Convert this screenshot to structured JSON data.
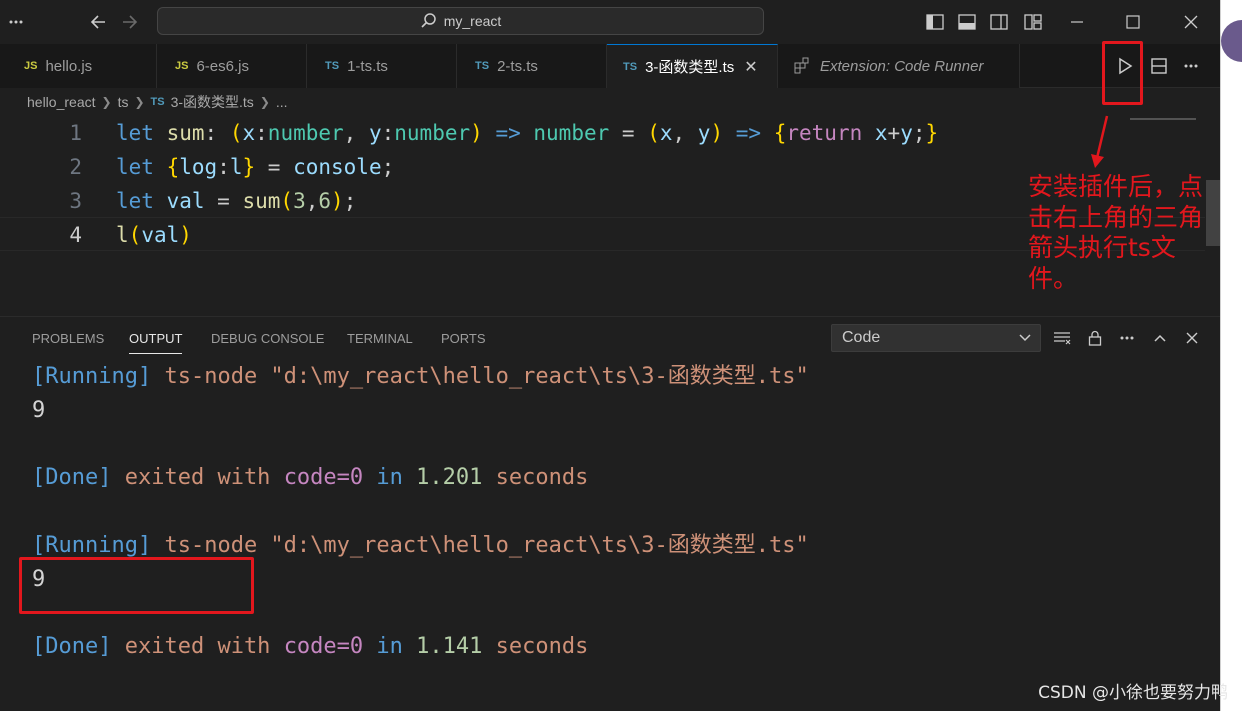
{
  "titlebar": {
    "search_text": "my_react",
    "menu_icon": "more-icon"
  },
  "tabs": [
    {
      "type": "JS",
      "label": "hello.js"
    },
    {
      "type": "JS",
      "label": "6-es6.js"
    },
    {
      "type": "TS",
      "label": "1-ts.ts"
    },
    {
      "type": "TS",
      "label": "2-ts.ts"
    },
    {
      "type": "TS",
      "label": "3-函数类型.ts",
      "close": "✕"
    },
    {
      "label": "Extension: Code Runner"
    }
  ],
  "breadcrumb": {
    "root": "hello_react",
    "folder": "ts",
    "file_type": "TS",
    "file": "3-函数类型.ts",
    "more": "..."
  },
  "editor": {
    "line_numbers": [
      "1",
      "2",
      "3",
      "4"
    ]
  },
  "annotation": {
    "text": "安装插件后，点击右上角的三角箭头执行ts文件。"
  },
  "panel": {
    "tabs": [
      "PROBLEMS",
      "OUTPUT",
      "DEBUG CONSOLE",
      "TERMINAL",
      "PORTS"
    ],
    "channel": "Code",
    "output": {
      "run1_tag": "[Running]",
      "run1_cmd": "ts-node \"d:\\my_react\\hello_react\\ts\\3-函数类型.ts\"",
      "result1": "9",
      "done1_tag": "[Done]",
      "done1_exited": "exited with",
      "done1_code": "code=0",
      "done1_in": "in",
      "done1_time": "1.201",
      "done1_seconds": "seconds",
      "run2_tag": "[Running]",
      "run2_cmd": "ts-node \"d:\\my_react\\hello_react\\ts\\3-函数类型.ts\"",
      "result2": "9",
      "done2_tag": "[Done]",
      "done2_exited": "exited with",
      "done2_code": "code=0",
      "done2_in": "in",
      "done2_time": "1.141",
      "done2_seconds": "seconds"
    }
  },
  "watermark": "CSDN @小徐也要努力鸭",
  "colors": {
    "accent": "#0078d4",
    "annotation_red": "#e2171d"
  }
}
